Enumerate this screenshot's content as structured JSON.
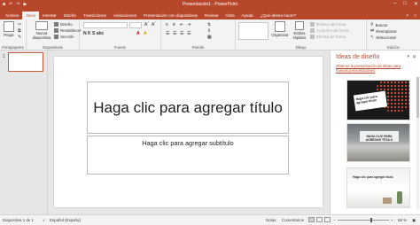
{
  "window": {
    "title": "Presentación1 - PowerPoint",
    "qat_icons": [
      "save-icon",
      "undo-icon",
      "redo-icon",
      "present-icon"
    ],
    "controls": [
      "minimize",
      "restore",
      "close"
    ],
    "controls_glyphs": [
      "–",
      "□",
      "✕"
    ]
  },
  "ribbon_tabs": [
    "Archivo",
    "Inicio",
    "Insertar",
    "Diseño",
    "Transiciones",
    "Animaciones",
    "Presentación con diapositivas",
    "Revisar",
    "Vista",
    "Ayuda",
    "¿Qué desea hacer?"
  ],
  "ribbon_active_tab": "Inicio",
  "ribbon": {
    "clipboard": {
      "group": "Portapapeles",
      "paste": "Pegar"
    },
    "slides": {
      "group": "Diapositivas",
      "new_slide_line1": "Nueva",
      "new_slide_line2": "diapositiva",
      "layout": "Diseño",
      "reset": "Restablecer",
      "section": "Sección"
    },
    "font": {
      "group": "Fuente",
      "format_buttons": "N K S abc"
    },
    "paragraph": {
      "group": "Párrafo"
    },
    "drawing": {
      "group": "Dibujo",
      "arrange": "Organizar",
      "quick_styles_line1": "Estilos",
      "quick_styles_line2": "rápidos",
      "shape_fill": "Relleno de forma",
      "shape_outline": "Contorno de forma",
      "shape_effects": "Efectos de forma"
    },
    "editing": {
      "group": "Edición",
      "find": "Buscar",
      "replace": "Reemplazar",
      "select": "Seleccionar"
    }
  },
  "slides": [
    {
      "number": "1"
    }
  ],
  "slide": {
    "title_placeholder": "Haga clic para agregar título",
    "subtitle_placeholder": "Haga clic para agregar subtítulo"
  },
  "design_ideas": {
    "title": "Ideas de diseño",
    "link": "Obtener la presentación de ideas para nuevas presentaciones",
    "idea1_caption": "Haga clic para agregar título",
    "idea2_caption": "HAGA CLIC PARA AGREGAR TÍTULO",
    "idea3_caption": "Haga clic para agregar título"
  },
  "status": {
    "slide_count": "Diapositiva 1 de 1",
    "language": "Español (España)",
    "notes": "Notas",
    "comments": "Comentarios",
    "zoom": "68 %"
  },
  "colors": {
    "accent": "#b7472a",
    "ribbon_bg": "#f3f3f3",
    "workspace": "#e6e6e6"
  }
}
